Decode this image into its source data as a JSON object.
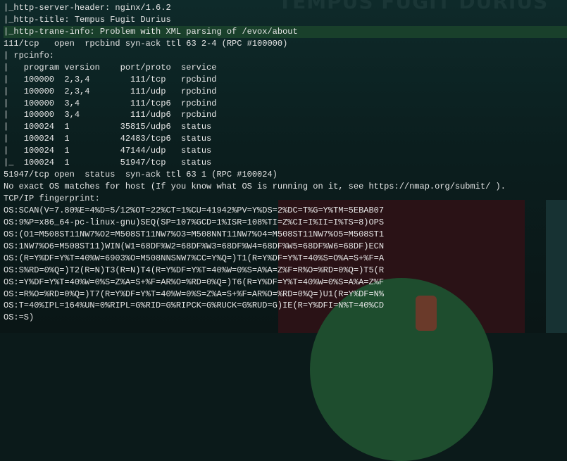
{
  "terminal": {
    "background_title": "TEMPUS FUGIT DURIUS",
    "lines": [
      "|_http-server-header: nginx/1.6.2",
      "|_http-title: Tempus Fugit Durius",
      "|_http-trane-info: Problem with XML parsing of /evox/about",
      "111/tcp   open  rpcbind syn-ack ttl 63 2-4 (RPC #100000)",
      "| rpcinfo:",
      "|   program version    port/proto  service",
      "|   100000  2,3,4        111/tcp   rpcbind",
      "|   100000  2,3,4        111/udp   rpcbind",
      "|   100000  3,4          111/tcp6  rpcbind",
      "|   100000  3,4          111/udp6  rpcbind",
      "|   100024  1          35815/udp6  status",
      "|   100024  1          42483/tcp6  status",
      "|   100024  1          47144/udp   status",
      "|_  100024  1          51947/tcp   status",
      "51947/tcp open  status  syn-ack ttl 63 1 (RPC #100024)",
      "No exact OS matches for host (If you know what OS is running on it, see https://nmap.org/submit/ ).",
      "TCP/IP fingerprint:",
      "OS:SCAN(V=7.80%E=4%D=5/12%OT=22%CT=1%CU=41942%PV=Y%DS=2%DC=T%G=Y%TM=5EBAB07",
      "OS:9%P=x86_64-pc-linux-gnu)SEQ(SP=107%GCD=1%ISR=108%TI=Z%CI=I%II=I%TS=8)OPS",
      "OS:(O1=M508ST11NW7%O2=M508ST11NW7%O3=M508NNT11NW7%O4=M508ST11NW7%O5=M508ST1",
      "OS:1NW7%O6=M508ST11)WIN(W1=68DF%W2=68DF%W3=68DF%W4=68DF%W5=68DF%W6=68DF)ECN",
      "OS:(R=Y%DF=Y%T=40%W=6903%O=M508NNSNW7%CC=Y%Q=)T1(R=Y%DF=Y%T=40%S=O%A=S+%F=A",
      "OS:S%RD=0%Q=)T2(R=N)T3(R=N)T4(R=Y%DF=Y%T=40%W=0%S=A%A=Z%F=R%O=%RD=0%Q=)T5(R",
      "OS:=Y%DF=Y%T=40%W=0%S=Z%A=S+%F=AR%O=%RD=0%Q=)T6(R=Y%DF=Y%T=40%W=0%S=A%A=Z%F",
      "OS:=R%O=%RD=0%Q=)T7(R=Y%DF=Y%T=40%W=0%S=Z%A=S+%F=AR%O=%RD=0%Q=)U1(R=Y%DF=N%",
      "OS:T=40%IPL=164%UN=0%RIPL=G%RID=G%RIPCK=G%RUCK=G%RUD=G)IE(R=Y%DFI=N%T=40%CD",
      "OS:=S)"
    ],
    "highlighted_line_index": 2
  }
}
